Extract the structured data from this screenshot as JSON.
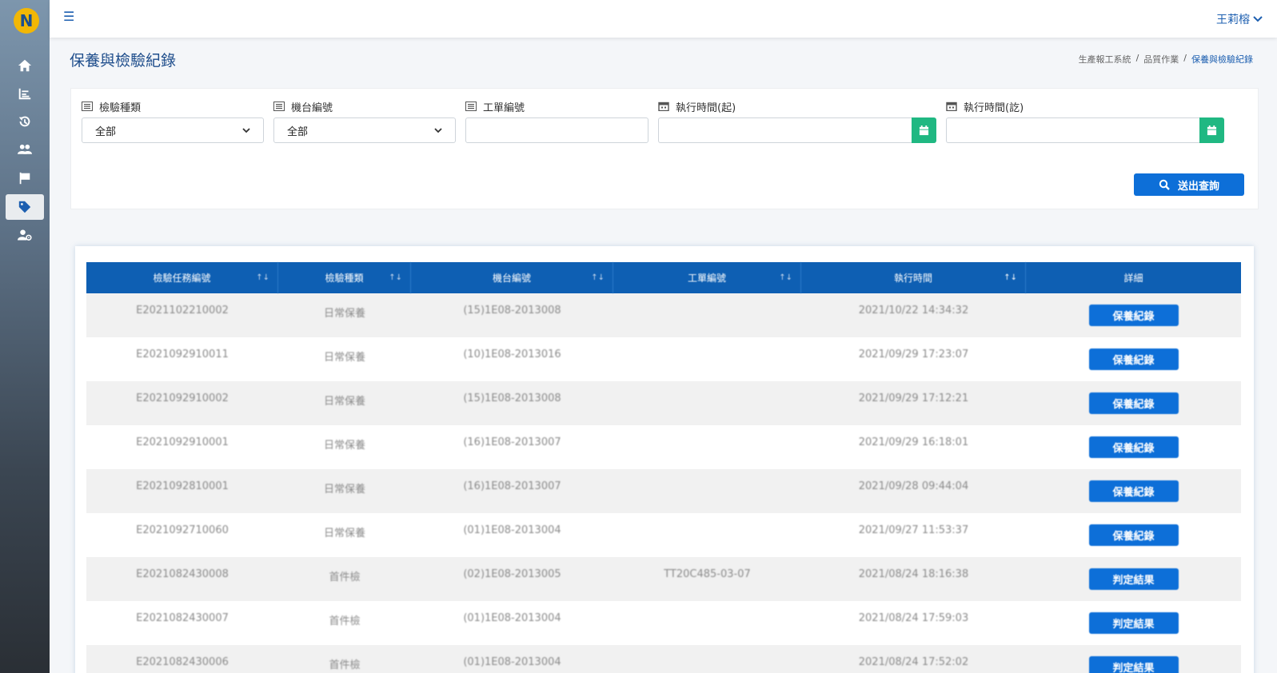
{
  "app": {
    "logo_letter": "N",
    "accent": "#0d6fd8",
    "header_blue": "#0e5fb3",
    "success_green": "#20b882"
  },
  "sidebar": {
    "items": [
      {
        "icon": "home-icon"
      },
      {
        "icon": "chart-icon"
      },
      {
        "icon": "history-icon"
      },
      {
        "icon": "users-icon"
      },
      {
        "icon": "flag-icon"
      },
      {
        "icon": "tag-icon",
        "active": true
      },
      {
        "icon": "user-gear-icon"
      }
    ]
  },
  "topbar": {
    "menu_icon": "☰",
    "user_name": "王莉榕",
    "chevron": "⌄"
  },
  "page": {
    "title": "保養與檢驗紀錄",
    "breadcrumb": [
      "生產報工系統",
      "品質作業",
      "保養與檢驗紀錄"
    ],
    "breadcrumb_sep": "/"
  },
  "filters": {
    "inspection_type": {
      "label": "檢驗種類",
      "value": "全部"
    },
    "machine_no": {
      "label": "機台編號",
      "value": "全部"
    },
    "work_order": {
      "label": "工單編號",
      "value": ""
    },
    "exec_start": {
      "label": "執行時間(起)",
      "value": ""
    },
    "exec_end": {
      "label": "執行時間(訖)",
      "value": ""
    },
    "submit_label": "送出查詢"
  },
  "table": {
    "headers": [
      "檢驗任務編號",
      "檢驗種類",
      "機台編號",
      "工單編號",
      "執行時間",
      "詳細"
    ],
    "rows": [
      {
        "id": "E2021102210002",
        "type": "日常保養",
        "machine": "(15)1E08-2013008",
        "order": "",
        "time": "2021/10/22 14:34:32",
        "action": "保養紀錄"
      },
      {
        "id": "E2021092910011",
        "type": "日常保養",
        "machine": "(10)1E08-2013016",
        "order": "",
        "time": "2021/09/29 17:23:07",
        "action": "保養紀錄"
      },
      {
        "id": "E2021092910002",
        "type": "日常保養",
        "machine": "(15)1E08-2013008",
        "order": "",
        "time": "2021/09/29 17:12:21",
        "action": "保養紀錄"
      },
      {
        "id": "E2021092910001",
        "type": "日常保養",
        "machine": "(16)1E08-2013007",
        "order": "",
        "time": "2021/09/29 16:18:01",
        "action": "保養紀錄"
      },
      {
        "id": "E2021092810001",
        "type": "日常保養",
        "machine": "(16)1E08-2013007",
        "order": "",
        "time": "2021/09/28 09:44:04",
        "action": "保養紀錄"
      },
      {
        "id": "E2021092710060",
        "type": "日常保養",
        "machine": "(01)1E08-2013004",
        "order": "",
        "time": "2021/09/27 11:53:37",
        "action": "保養紀錄"
      },
      {
        "id": "E2021082430008",
        "type": "首件檢",
        "machine": "(02)1E08-2013005",
        "order": "TT20C485-03-07",
        "time": "2021/08/24 18:16:38",
        "action": "判定結果"
      },
      {
        "id": "E2021082430007",
        "type": "首件檢",
        "machine": "(01)1E08-2013004",
        "order": "",
        "time": "2021/08/24 17:59:03",
        "action": "判定結果"
      },
      {
        "id": "E2021082430006",
        "type": "首件檢",
        "machine": "(01)1E08-2013004",
        "order": "",
        "time": "2021/08/24 17:52:02",
        "action": "判定結果"
      }
    ]
  }
}
